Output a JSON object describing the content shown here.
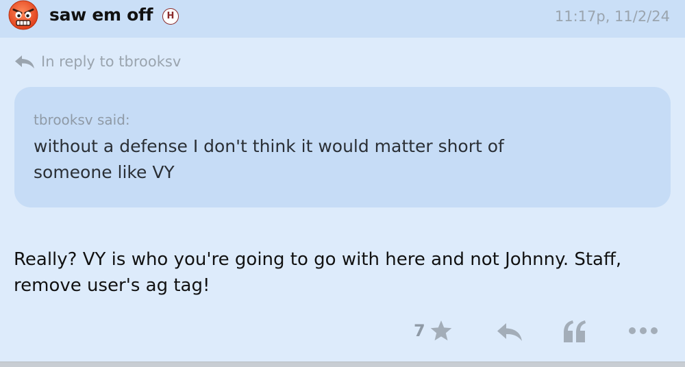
{
  "header": {
    "username": "saw em off",
    "badge": "H",
    "timestamp": "11:17p, 11/2/24",
    "avatar_icon": "angry-face-icon"
  },
  "reply": {
    "label": "In reply to tbrooksv"
  },
  "quote": {
    "author": "tbrooksv said:",
    "lines": [
      "without a defense I don't think it would matter short of",
      "someone like VY"
    ]
  },
  "post": {
    "lines": [
      "Really? VY is who you're going to go with here and not Johnny. Staff,",
      "remove user's ag tag!"
    ]
  },
  "actions": {
    "like_count": "7",
    "icons": [
      "star-icon",
      "reply-icon",
      "quote-icon",
      "more-icon"
    ]
  },
  "colors": {
    "header_bg": "#cadff7",
    "page_bg": "#ddebfb",
    "quote_bg": "#c6dcf6",
    "muted": "#9aa4ae",
    "badge": "#8a2a2a"
  }
}
